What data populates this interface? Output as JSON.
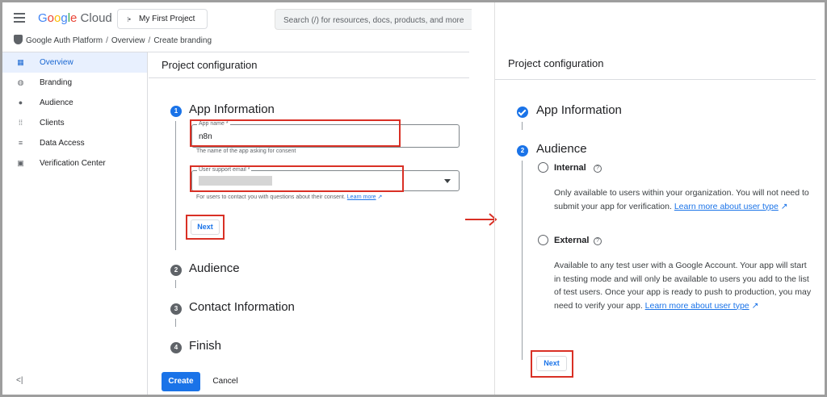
{
  "header": {
    "logo": {
      "g1": "G",
      "g2": "o",
      "g3": "o",
      "g4": "g",
      "g5": "l",
      "g6": "e",
      "cloud": " Cloud"
    },
    "project_label": "My First Project",
    "search_placeholder": "Search (/) for resources, docs, products, and more"
  },
  "breadcrumb": [
    "Google Auth Platform",
    "Overview",
    "Create branding"
  ],
  "sidebar": {
    "items": [
      {
        "label": "Overview",
        "icon": "grid-icon",
        "active": true
      },
      {
        "label": "Branding",
        "icon": "palette-icon"
      },
      {
        "label": "Audience",
        "icon": "person-icon"
      },
      {
        "label": "Clients",
        "icon": "apps-icon"
      },
      {
        "label": "Data Access",
        "icon": "filter-icon"
      },
      {
        "label": "Verification Center",
        "icon": "checklist-icon"
      }
    ],
    "collapse_label": "<|"
  },
  "left": {
    "panel_title": "Project configuration",
    "steps": [
      {
        "num": "1",
        "title": "App Information"
      },
      {
        "num": "2",
        "title": "Audience"
      },
      {
        "num": "3",
        "title": "Contact Information"
      },
      {
        "num": "4",
        "title": "Finish"
      }
    ],
    "app_name": {
      "label": "App name *",
      "value": "n8n",
      "help": "The name of the app asking for consent"
    },
    "support_email": {
      "label": "User support email *",
      "help": "For users to contact you with questions about their consent.",
      "learn_more": "Learn more"
    },
    "next_label": "Next",
    "create_label": "Create",
    "cancel_label": "Cancel"
  },
  "right": {
    "panel_title": "Project configuration",
    "step1_title": "App Information",
    "step2_num": "2",
    "step2_title": "Audience",
    "internal": {
      "label": "Internal",
      "desc": "Only available to users within your organization. You will not need to submit your app for verification.",
      "link": "Learn more about user type"
    },
    "external": {
      "label": "External",
      "desc": "Available to any test user with a Google Account. Your app will start in testing mode and will only be available to users you add to the list of test users. Once your app is ready to push to production, you may need to verify your app.",
      "link": "Learn more about user type"
    },
    "next_label": "Next"
  },
  "colors": {
    "accent": "#1a73e8",
    "highlight_box": "#d93025",
    "arrow": "#d93025"
  }
}
